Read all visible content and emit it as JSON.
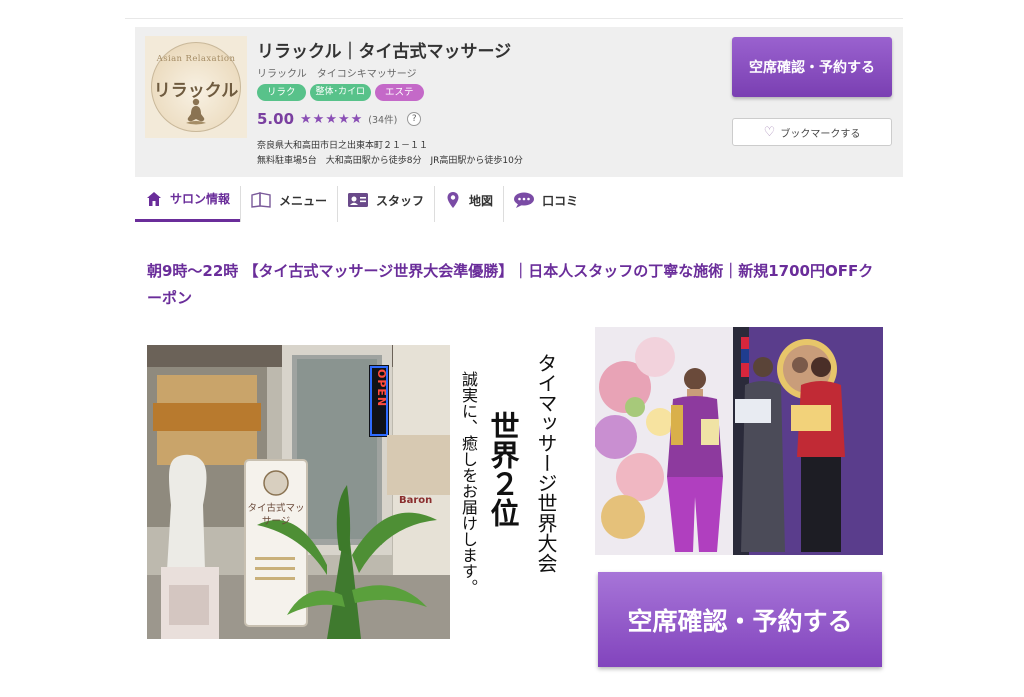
{
  "salon": {
    "logo_arc": "Asian Relaxation",
    "logo_name": "リラックル",
    "name": "リラックル｜タイ古式マッサージ",
    "kana": "リラックル　タイコシキマッサージ",
    "tags": [
      "リラク",
      "整体･カイロ",
      "エステ"
    ],
    "rating": "5.00",
    "stars": 5,
    "review_count": "(34件)",
    "help": "?",
    "address": "奈良県大和高田市日之出東本町２１－１１",
    "access": "無料駐車場5台　大和高田駅から徒歩8分　JR高田駅から徒歩10分"
  },
  "buttons": {
    "reserve": "空席確認・予約する",
    "bookmark": "ブックマークする",
    "reserve_large": "空席確認・予約する"
  },
  "tabs": [
    {
      "label": "サロン情報",
      "icon": "home-icon"
    },
    {
      "label": "メニュー",
      "icon": "book-icon"
    },
    {
      "label": "スタッフ",
      "icon": "staff-card-icon"
    },
    {
      "label": "地図",
      "icon": "map-pin-icon"
    },
    {
      "label": "口コミ",
      "icon": "chat-bubble-icon"
    }
  ],
  "catch_copy": "朝9時～22時 【タイ古式マッサージ世界大会準優勝】｜日本人スタッフの丁寧な施術｜新規1700円OFFクーポン",
  "photo_text": {
    "col1": "タイマッサージ世界大会",
    "col2": "世界２位",
    "col3": "誠実に、癒しをお届けします。",
    "shop_sign": "タイ古式マッサージ",
    "open_sign": "OPEN",
    "baron_sign": "Baron"
  },
  "colors": {
    "accent": "#6a2d9a",
    "button": "#8a50c2",
    "tag_green": "#58c28a",
    "tag_pink": "#c469c8"
  }
}
